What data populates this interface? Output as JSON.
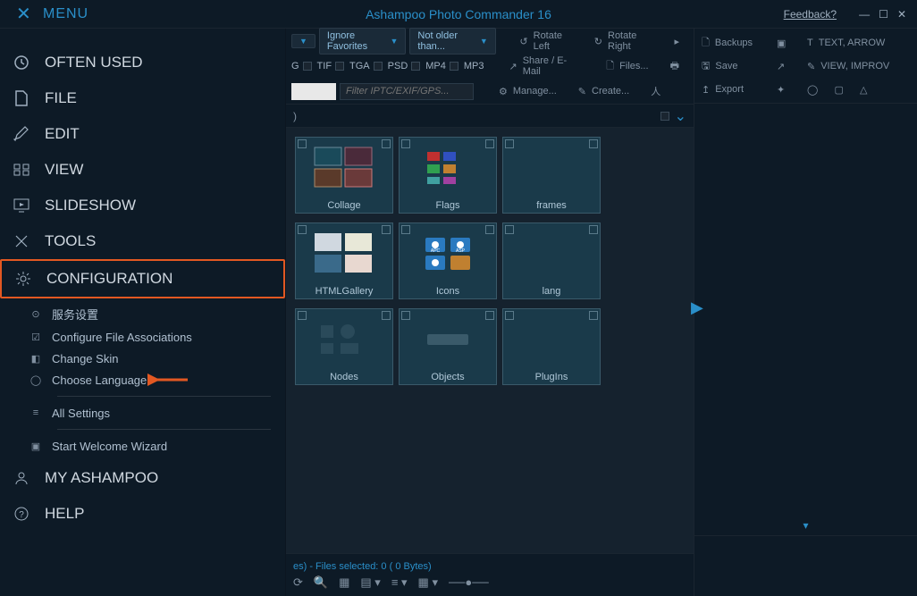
{
  "titlebar": {
    "menu": "MENU",
    "app_title": "Ashampoo Photo Commander 16",
    "feedback": "Feedback?"
  },
  "sidebar": {
    "often_used": "OFTEN USED",
    "file": "FILE",
    "edit": "EDIT",
    "view": "VIEW",
    "slideshow": "SLIDESHOW",
    "tools": "TOOLS",
    "configuration": "CONFIGURATION",
    "config_sub": {
      "service": "服务设置",
      "file_assoc": "Configure File Associations",
      "skin": "Change Skin",
      "language": "Choose Language",
      "all_settings": "All Settings",
      "wizard": "Start Welcome Wizard"
    },
    "my_ashampoo": "MY ASHAMPOO",
    "help": "HELP"
  },
  "toolbar": {
    "ignore_favorites": "Ignore Favorites",
    "not_older": "Not older than...",
    "rotate_left": "Rotate Left",
    "rotate_right": "Rotate Right",
    "share": "Share / E-Mail",
    "files": "Files...",
    "manage": "Manage...",
    "create": "Create...",
    "fmt_g": "G",
    "fmt_tif": "TIF",
    "fmt_tga": "TGA",
    "fmt_psd": "PSD",
    "fmt_mp4": "MP4",
    "fmt_mp3": "MP3",
    "filter_placeholder": "Filter IPTC/EXIF/GPS..."
  },
  "viewhead": {
    "paren": ")"
  },
  "folders": [
    {
      "label": "Collage"
    },
    {
      "label": "Flags"
    },
    {
      "label": "frames"
    },
    {
      "label": "HTMLGallery"
    },
    {
      "label": "Icons"
    },
    {
      "label": "lang"
    },
    {
      "label": "Nodes"
    },
    {
      "label": "Objects"
    },
    {
      "label": "PlugIns"
    }
  ],
  "statusbar": {
    "text": "es) - Files selected: 0 (   0 Bytes)"
  },
  "rightbar": {
    "backups": "Backups",
    "save": "Save",
    "export": "Export",
    "text_arrow": "TEXT, ARROW",
    "view_improv": "VIEW, IMPROV"
  }
}
